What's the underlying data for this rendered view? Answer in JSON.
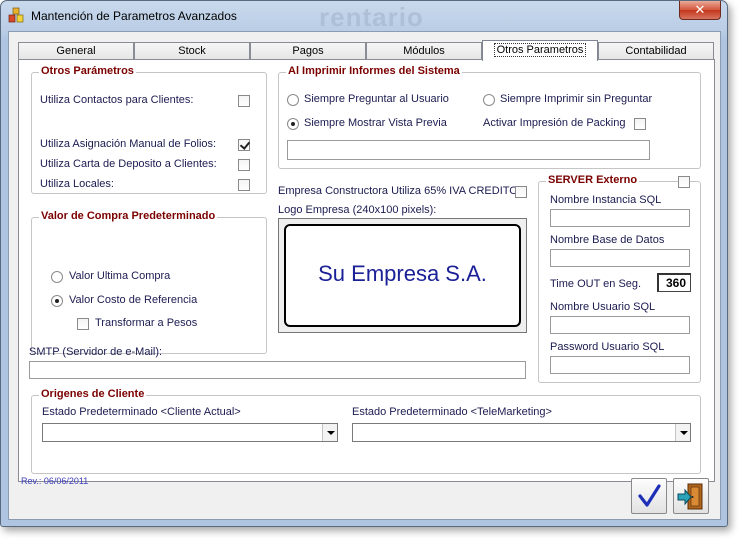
{
  "window": {
    "title": "Mantención de Parametros Avanzados",
    "watermark": "rentario",
    "close_glyph": "✕"
  },
  "tabs": [
    {
      "label": "General"
    },
    {
      "label": "Stock"
    },
    {
      "label": "Pagos"
    },
    {
      "label": "Módulos"
    },
    {
      "label": "Otros Parametros",
      "active": true
    },
    {
      "label": "Contabilidad"
    }
  ],
  "otros": {
    "title": "Otros Parámetros",
    "items": [
      {
        "label": "Utiliza Contactos para Clientes:",
        "checked": false
      },
      {
        "label": "Utiliza Asignación Manual de Folios:",
        "checked": true
      },
      {
        "label": "Utiliza Carta de Deposito a Clientes:",
        "checked": false
      },
      {
        "label": "Utiliza Locales:",
        "checked": false
      }
    ]
  },
  "imprimir": {
    "title": "Al Imprimir Informes del Sistema",
    "opt_preguntar": "Siempre Preguntar al Usuario",
    "opt_sin_preguntar": "Siempre Imprimir sin Preguntar",
    "opt_vista_previa": "Siempre Mostrar Vista Previa",
    "packing_label": "Activar Impresión de Packing",
    "text_value": ""
  },
  "valor_compra": {
    "title": "Valor de Compra Predeterminado",
    "opt_ultima": "Valor Ultima Compra",
    "opt_costo": "Valor Costo de Referencia",
    "transformar": "Transformar a Pesos"
  },
  "iva_label": "Empresa Constructora Utiliza 65% IVA CREDITO",
  "logo": {
    "label": "Logo Empresa (240x100 pixels):",
    "text": "Su Empresa S.A."
  },
  "server": {
    "title": "SERVER Externo",
    "instancia_label": "Nombre Instancia SQL",
    "instancia_value": "",
    "base_label": "Nombre Base de Datos",
    "base_value": "",
    "timeout_label": "Time OUT en Seg.",
    "timeout_value": "360",
    "usuario_label": "Nombre Usuario SQL",
    "usuario_value": "",
    "password_label": "Password Usuario SQL",
    "password_value": ""
  },
  "smtp": {
    "label": "SMTP (Servidor de e-Mail):",
    "value": ""
  },
  "origenes": {
    "title": "Origenes de Cliente",
    "actual_label": "Estado Predeterminado <Cliente Actual>",
    "telemarketing_label": "Estado Predeterminado <TeleMarketing>"
  },
  "footer": {
    "revision": "Rev.: 06/06/2011"
  },
  "colors": {
    "accent_blue": "#1b2196",
    "group_title_red": "#7b0000"
  }
}
